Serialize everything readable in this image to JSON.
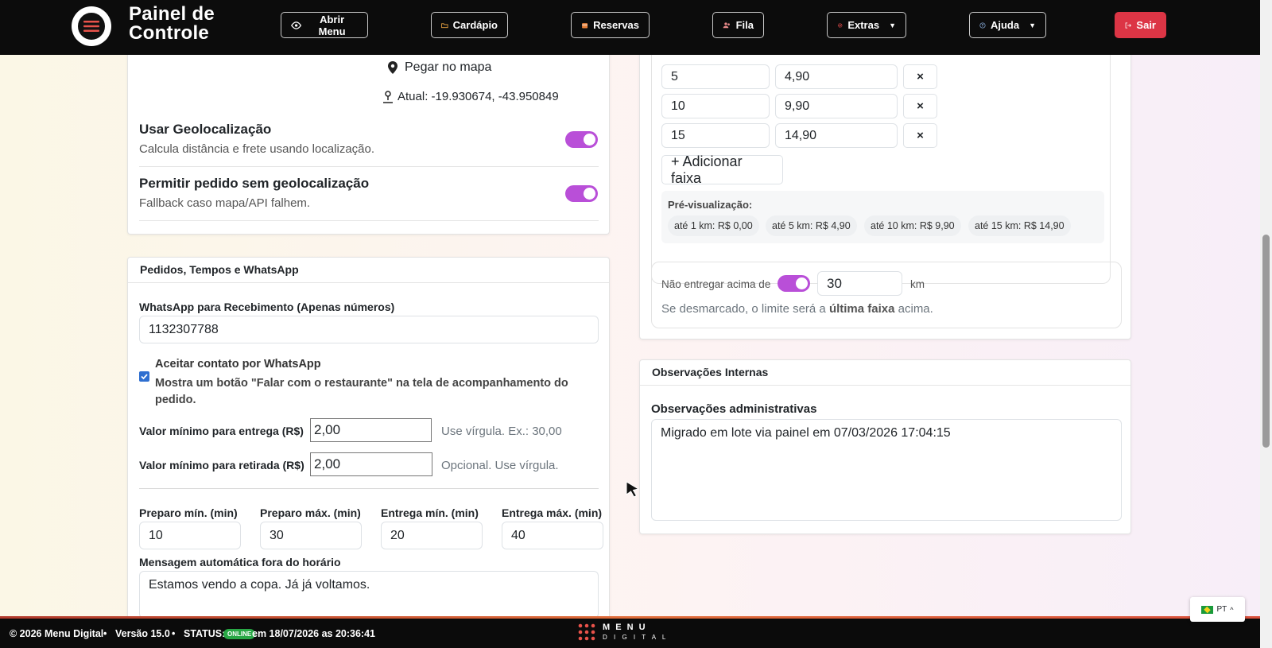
{
  "nav": {
    "brand": "Painel de Controle",
    "abrir_menu": "Abrir Menu",
    "cardapio": "Cardápio",
    "reservas": "Reservas",
    "fila": "Fila",
    "extras": "Extras",
    "ajuda": "Ajuda",
    "sair": "Sair"
  },
  "location": {
    "pick_map": "Pegar no mapa",
    "current": "Atual: -19.930674, -43.950849",
    "geo_title": "Usar Geolocalização",
    "geo_desc": "Calcula distância e frete usando localização.",
    "nogeo_title": "Permitir pedido sem geolocalização",
    "nogeo_desc": "Fallback caso mapa/API falhem."
  },
  "orders": {
    "header": "Pedidos, Tempos e WhatsApp",
    "whatsapp_label": "WhatsApp para Recebimento (Apenas números)",
    "whatsapp_value": "1132307788",
    "accept_title": "Aceitar contato por WhatsApp",
    "accept_desc": "Mostra um botão \"Falar com o restaurante\" na tela de acompanhamento do pedido.",
    "min_delivery_label": "Valor mínimo para entrega (R$)",
    "min_delivery_value": "2,00",
    "min_delivery_hint": "Use vírgula. Ex.: 30,00",
    "min_pickup_label": "Valor mínimo para retirada (R$)",
    "min_pickup_value": "2,00",
    "min_pickup_hint": "Opcional. Use vírgula.",
    "prep_min_label": "Preparo mín. (min)",
    "prep_min_value": "10",
    "prep_max_label": "Preparo máx. (min)",
    "prep_max_value": "30",
    "deliv_min_label": "Entrega mín. (min)",
    "deliv_min_value": "20",
    "deliv_max_label": "Entrega máx. (min)",
    "deliv_max_value": "40",
    "auto_msg_label": "Mensagem automática fora do horário",
    "auto_msg_value": "Estamos vendo a copa. Já já voltamos."
  },
  "ranges": {
    "rows": [
      {
        "km": "5",
        "price": "4,90",
        "remove": "×"
      },
      {
        "km": "10",
        "price": "9,90",
        "remove": "×"
      },
      {
        "km": "15",
        "price": "14,90",
        "remove": "×"
      }
    ],
    "add_label": "+ Adicionar faixa",
    "preview_label": "Pré-visualização:",
    "chips": [
      "até 1 km: R$ 0,00",
      "até 5 km: R$ 4,90",
      "até 10 km: R$ 9,90",
      "até 15 km: R$ 14,90"
    ],
    "limit_label": "Não entregar acima de",
    "limit_value": "30",
    "limit_unit": "km",
    "limit_hint_pre": "Se desmarcado, o limite será a",
    "limit_hint_bold": "última faixa",
    "limit_hint_post": "acima."
  },
  "notes": {
    "header": "Observações Internas",
    "label": "Observações administrativas",
    "value": "Migrado em lote via painel em 07/03/2026 17:04:15"
  },
  "footer": {
    "copyright": "© 2026 Menu Digital",
    "version": "Versão 15.0",
    "status_label": "STATUS:",
    "online": "ONLINE",
    "status_time": "em 18/07/2026 as 20:36:41",
    "logo_top": "M E N U",
    "logo_bottom": "D I G I T A L"
  },
  "lang": {
    "code": "PT"
  },
  "colors": {
    "accent": "#b94fd8",
    "danger": "#dc3545",
    "online": "#28a745"
  }
}
